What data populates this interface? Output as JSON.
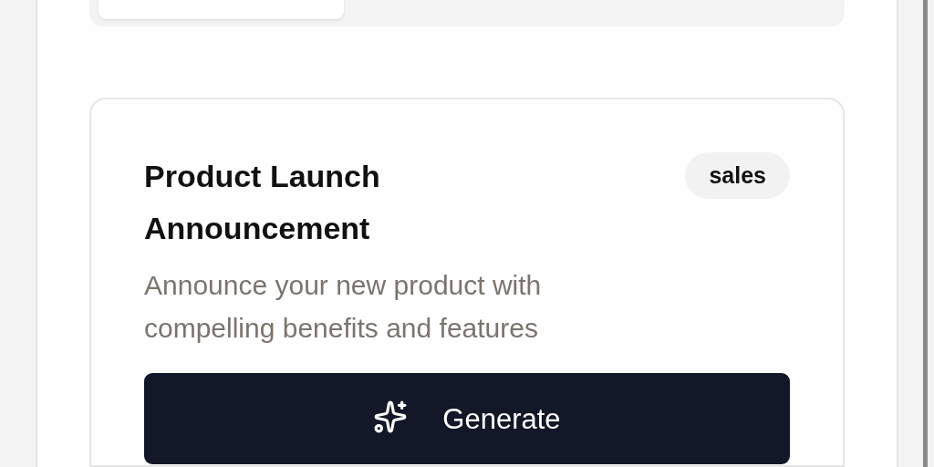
{
  "template": {
    "title": "Product Launch Announcement",
    "tag": "sales",
    "description": "Announce your new product with compelling benefits and features",
    "action": "Generate"
  }
}
